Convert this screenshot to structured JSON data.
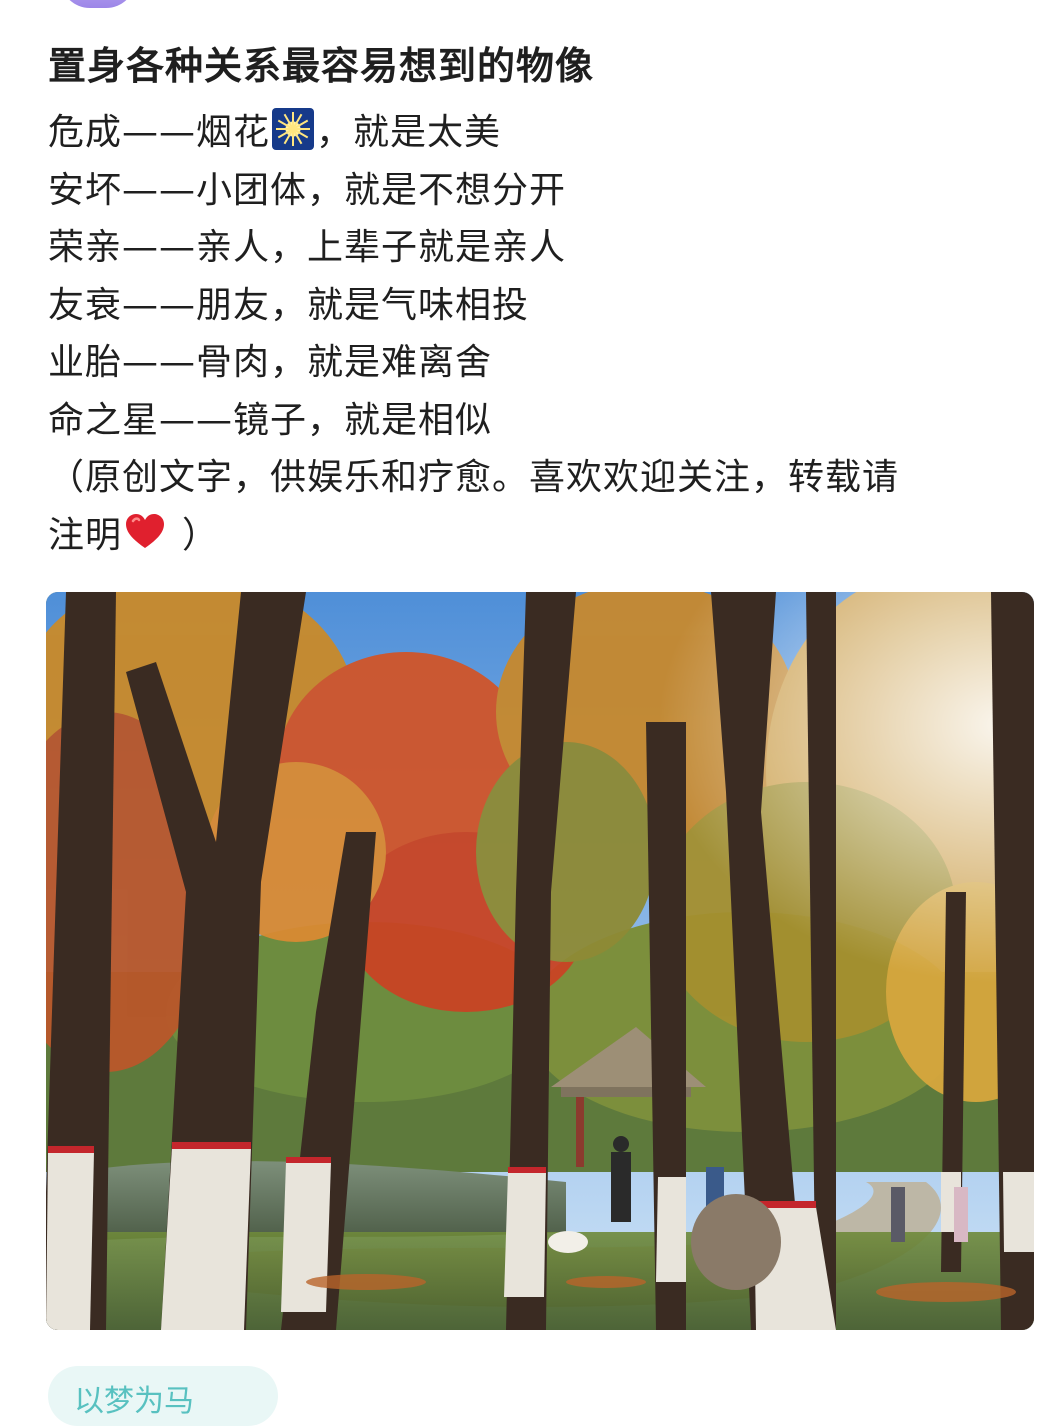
{
  "post": {
    "title": "置身各种关系最容易想到的物像",
    "lines": [
      {
        "before": "危成——烟花",
        "emoji": "fireworks-emoji",
        "after": "，就是太美"
      },
      {
        "text": "安坏——小团体，就是不想分开"
      },
      {
        "text": "荣亲——亲人，上辈子就是亲人"
      },
      {
        "text": "友衰——朋友，就是气味相投"
      },
      {
        "text": "业胎——骨肉，就是难离舍"
      },
      {
        "text": "命之星——镜子，就是相似"
      },
      {
        "text": "（原创文字，供娱乐和疗愈。喜欢欢迎关注，转载请"
      },
      {
        "before": "注明",
        "emoji": "red-heart-emoji",
        "after": "）"
      }
    ],
    "photo_icon": "autumn-park-photo"
  },
  "footer": {
    "chip_text": "以梦为马"
  },
  "colors": {
    "text": "#1f1f1f",
    "accent_purple": "#9d86e8",
    "chip_bg": "#e9f7f6",
    "chip_text": "#58c1c0"
  }
}
